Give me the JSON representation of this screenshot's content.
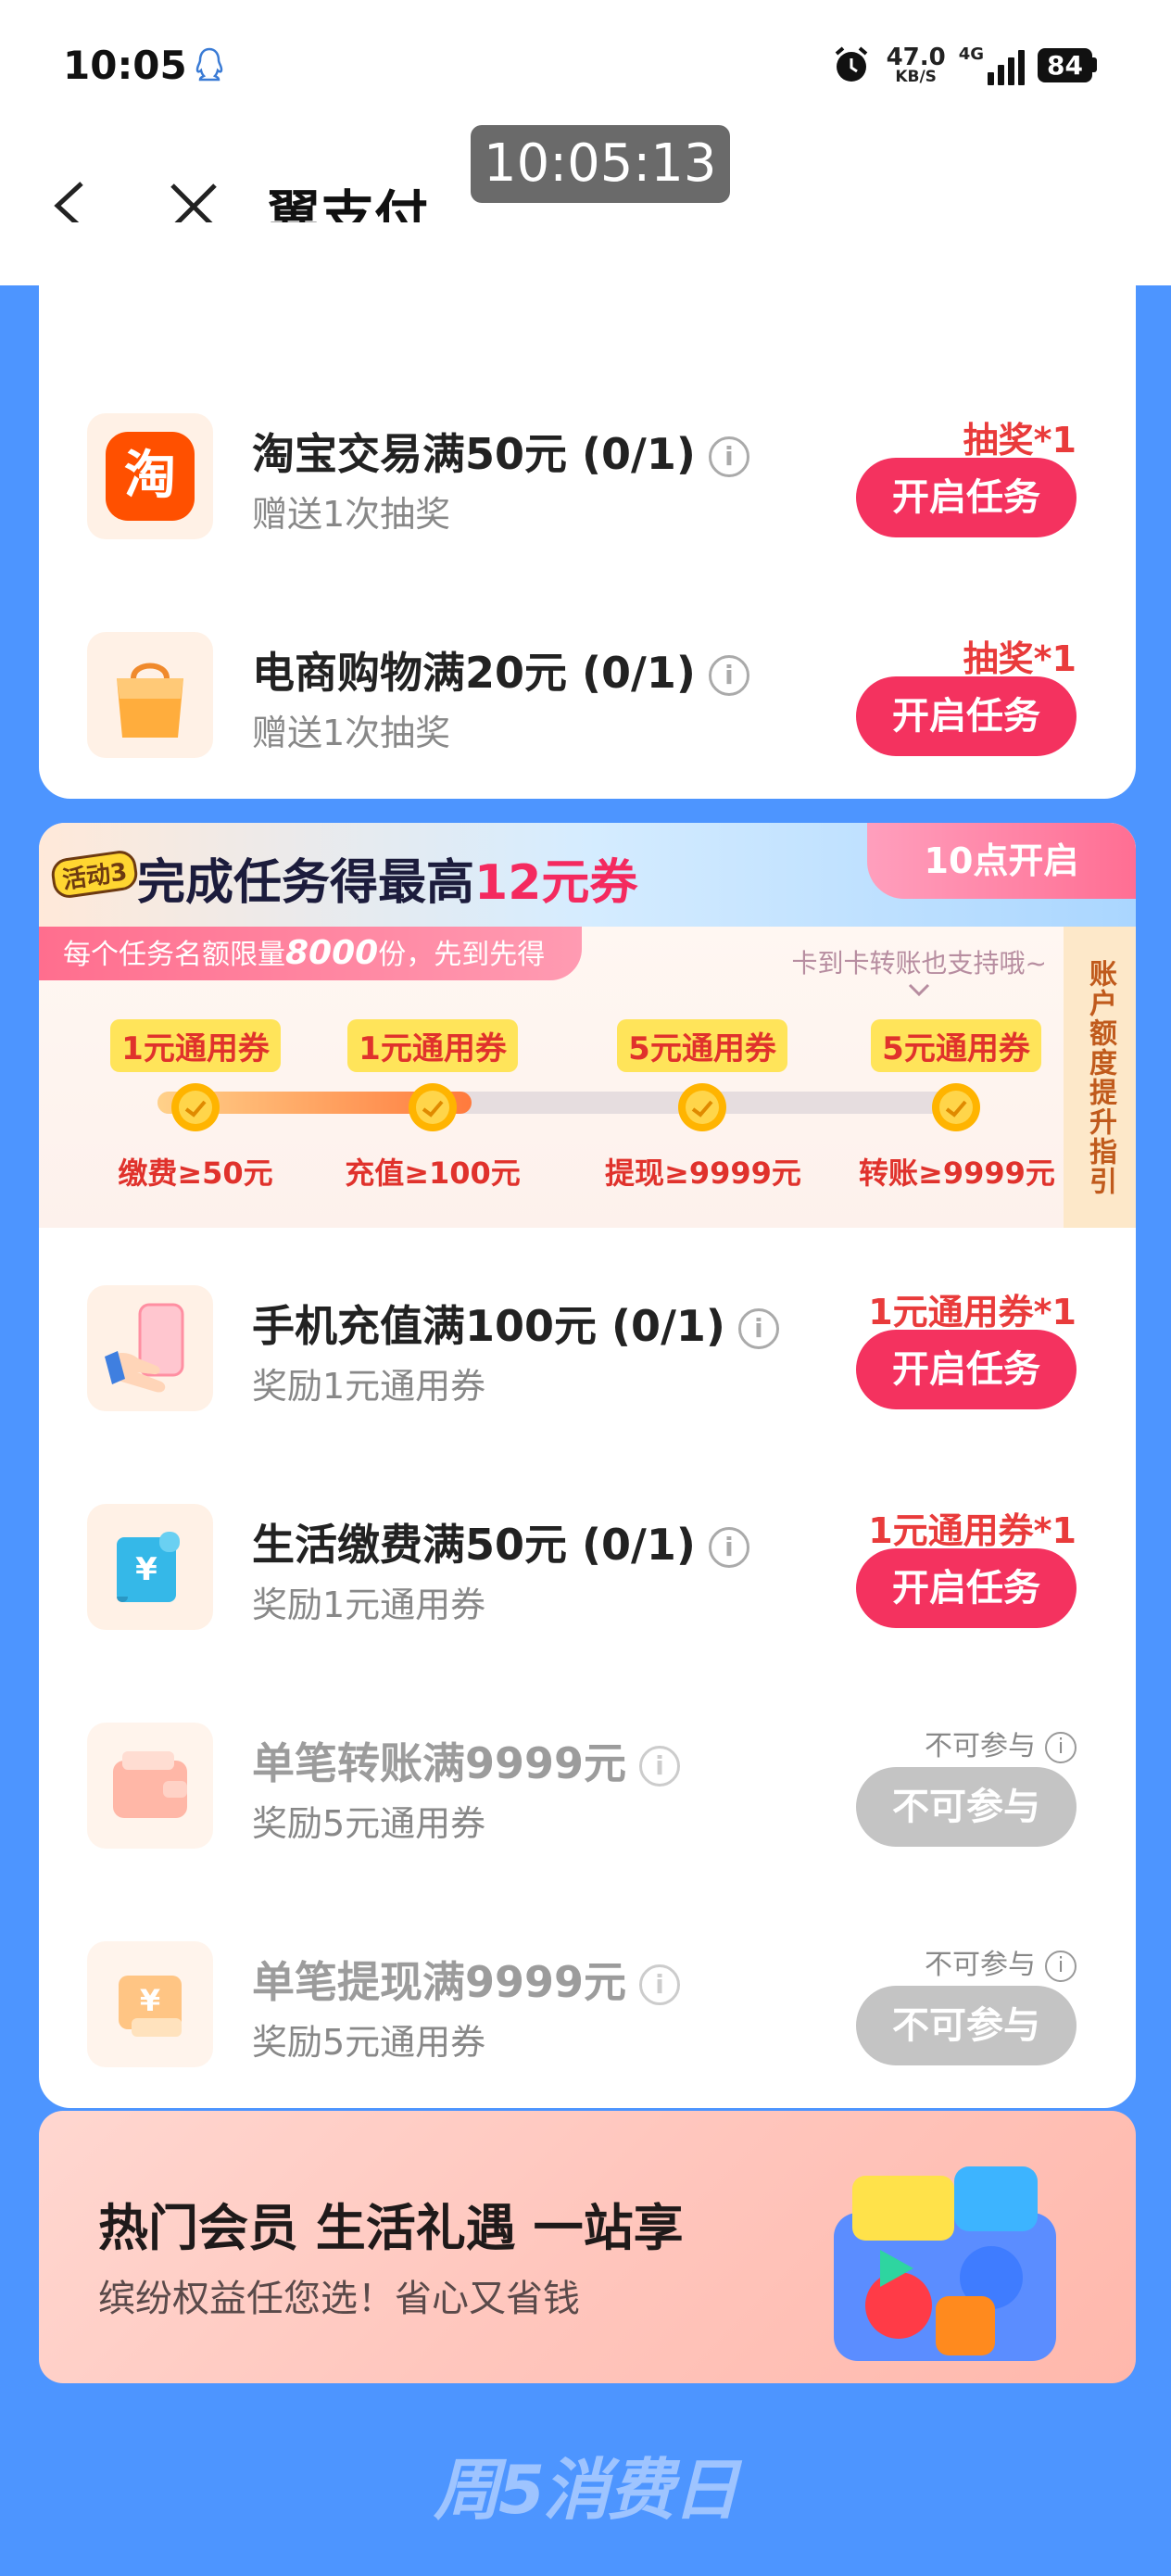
{
  "status_bar": {
    "time": "10:05",
    "speed_value": "47.0",
    "speed_unit": "KB/S",
    "network": "4G",
    "battery": "84"
  },
  "nav": {
    "title": "翼支付"
  },
  "overlay": {
    "timestamp": "10:05:13"
  },
  "tasks_top": [
    {
      "title": "淘宝交易满50元 (0/1)",
      "sub": "赠送1次抽奖",
      "reward": "抽奖*1",
      "button": "开启任务",
      "icon": "taobao-icon"
    },
    {
      "title": "电商购物满20元 (0/1)",
      "sub": "赠送1次抽奖",
      "reward": "抽奖*1",
      "button": "开启任务",
      "icon": "shopping-bag-icon"
    }
  ],
  "activity": {
    "tag": "活动3",
    "title_prefix": "完成任务得最高",
    "title_highlight": "12元券",
    "open_time": "10点开启",
    "limit_prefix": "每个任务名额限量",
    "limit_count": "8000",
    "limit_suffix": "份，先到先得",
    "support_note": "卡到卡转账也支持哦~",
    "side_guide": "账户额度提升指引",
    "progress_fraction": 0.39,
    "steps": [
      {
        "voucher": "1元通用券",
        "condition": "缴费≥50元"
      },
      {
        "voucher": "1元通用券",
        "condition": "充值≥100元"
      },
      {
        "voucher": "5元通用券",
        "condition": "提现≥9999元"
      },
      {
        "voucher": "5元通用券",
        "condition": "转账≥9999元"
      }
    ]
  },
  "tasks_bottom": [
    {
      "title": "手机充值满100元 (0/1)",
      "sub": "奖励1元通用券",
      "reward": "1元通用券*1",
      "button": "开启任务",
      "icon": "phone-recharge-icon",
      "enabled": true
    },
    {
      "title": "生活缴费满50元 (0/1)",
      "sub": "奖励1元通用券",
      "reward": "1元通用券*1",
      "button": "开启任务",
      "icon": "bill-payment-icon",
      "enabled": true
    },
    {
      "title": "单笔转账满9999元",
      "sub": "奖励5元通用券",
      "reward": "不可参与",
      "button": "不可参与",
      "icon": "wallet-icon",
      "enabled": false
    },
    {
      "title": "单笔提现满9999元",
      "sub": "奖励5元通用券",
      "reward": "不可参与",
      "button": "不可参与",
      "icon": "cash-card-icon",
      "enabled": false
    }
  ],
  "banner": {
    "headline": "热门会员 生活礼遇 一站享",
    "subline": "缤纷权益任您选！省心又省钱"
  },
  "footer": {
    "logo": "周5消费日"
  },
  "colors": {
    "page_bg": "#4d95ff",
    "primary_button": "#f4325f",
    "reward_red": "#e93b3b",
    "disabled": "#c4c4c4"
  }
}
